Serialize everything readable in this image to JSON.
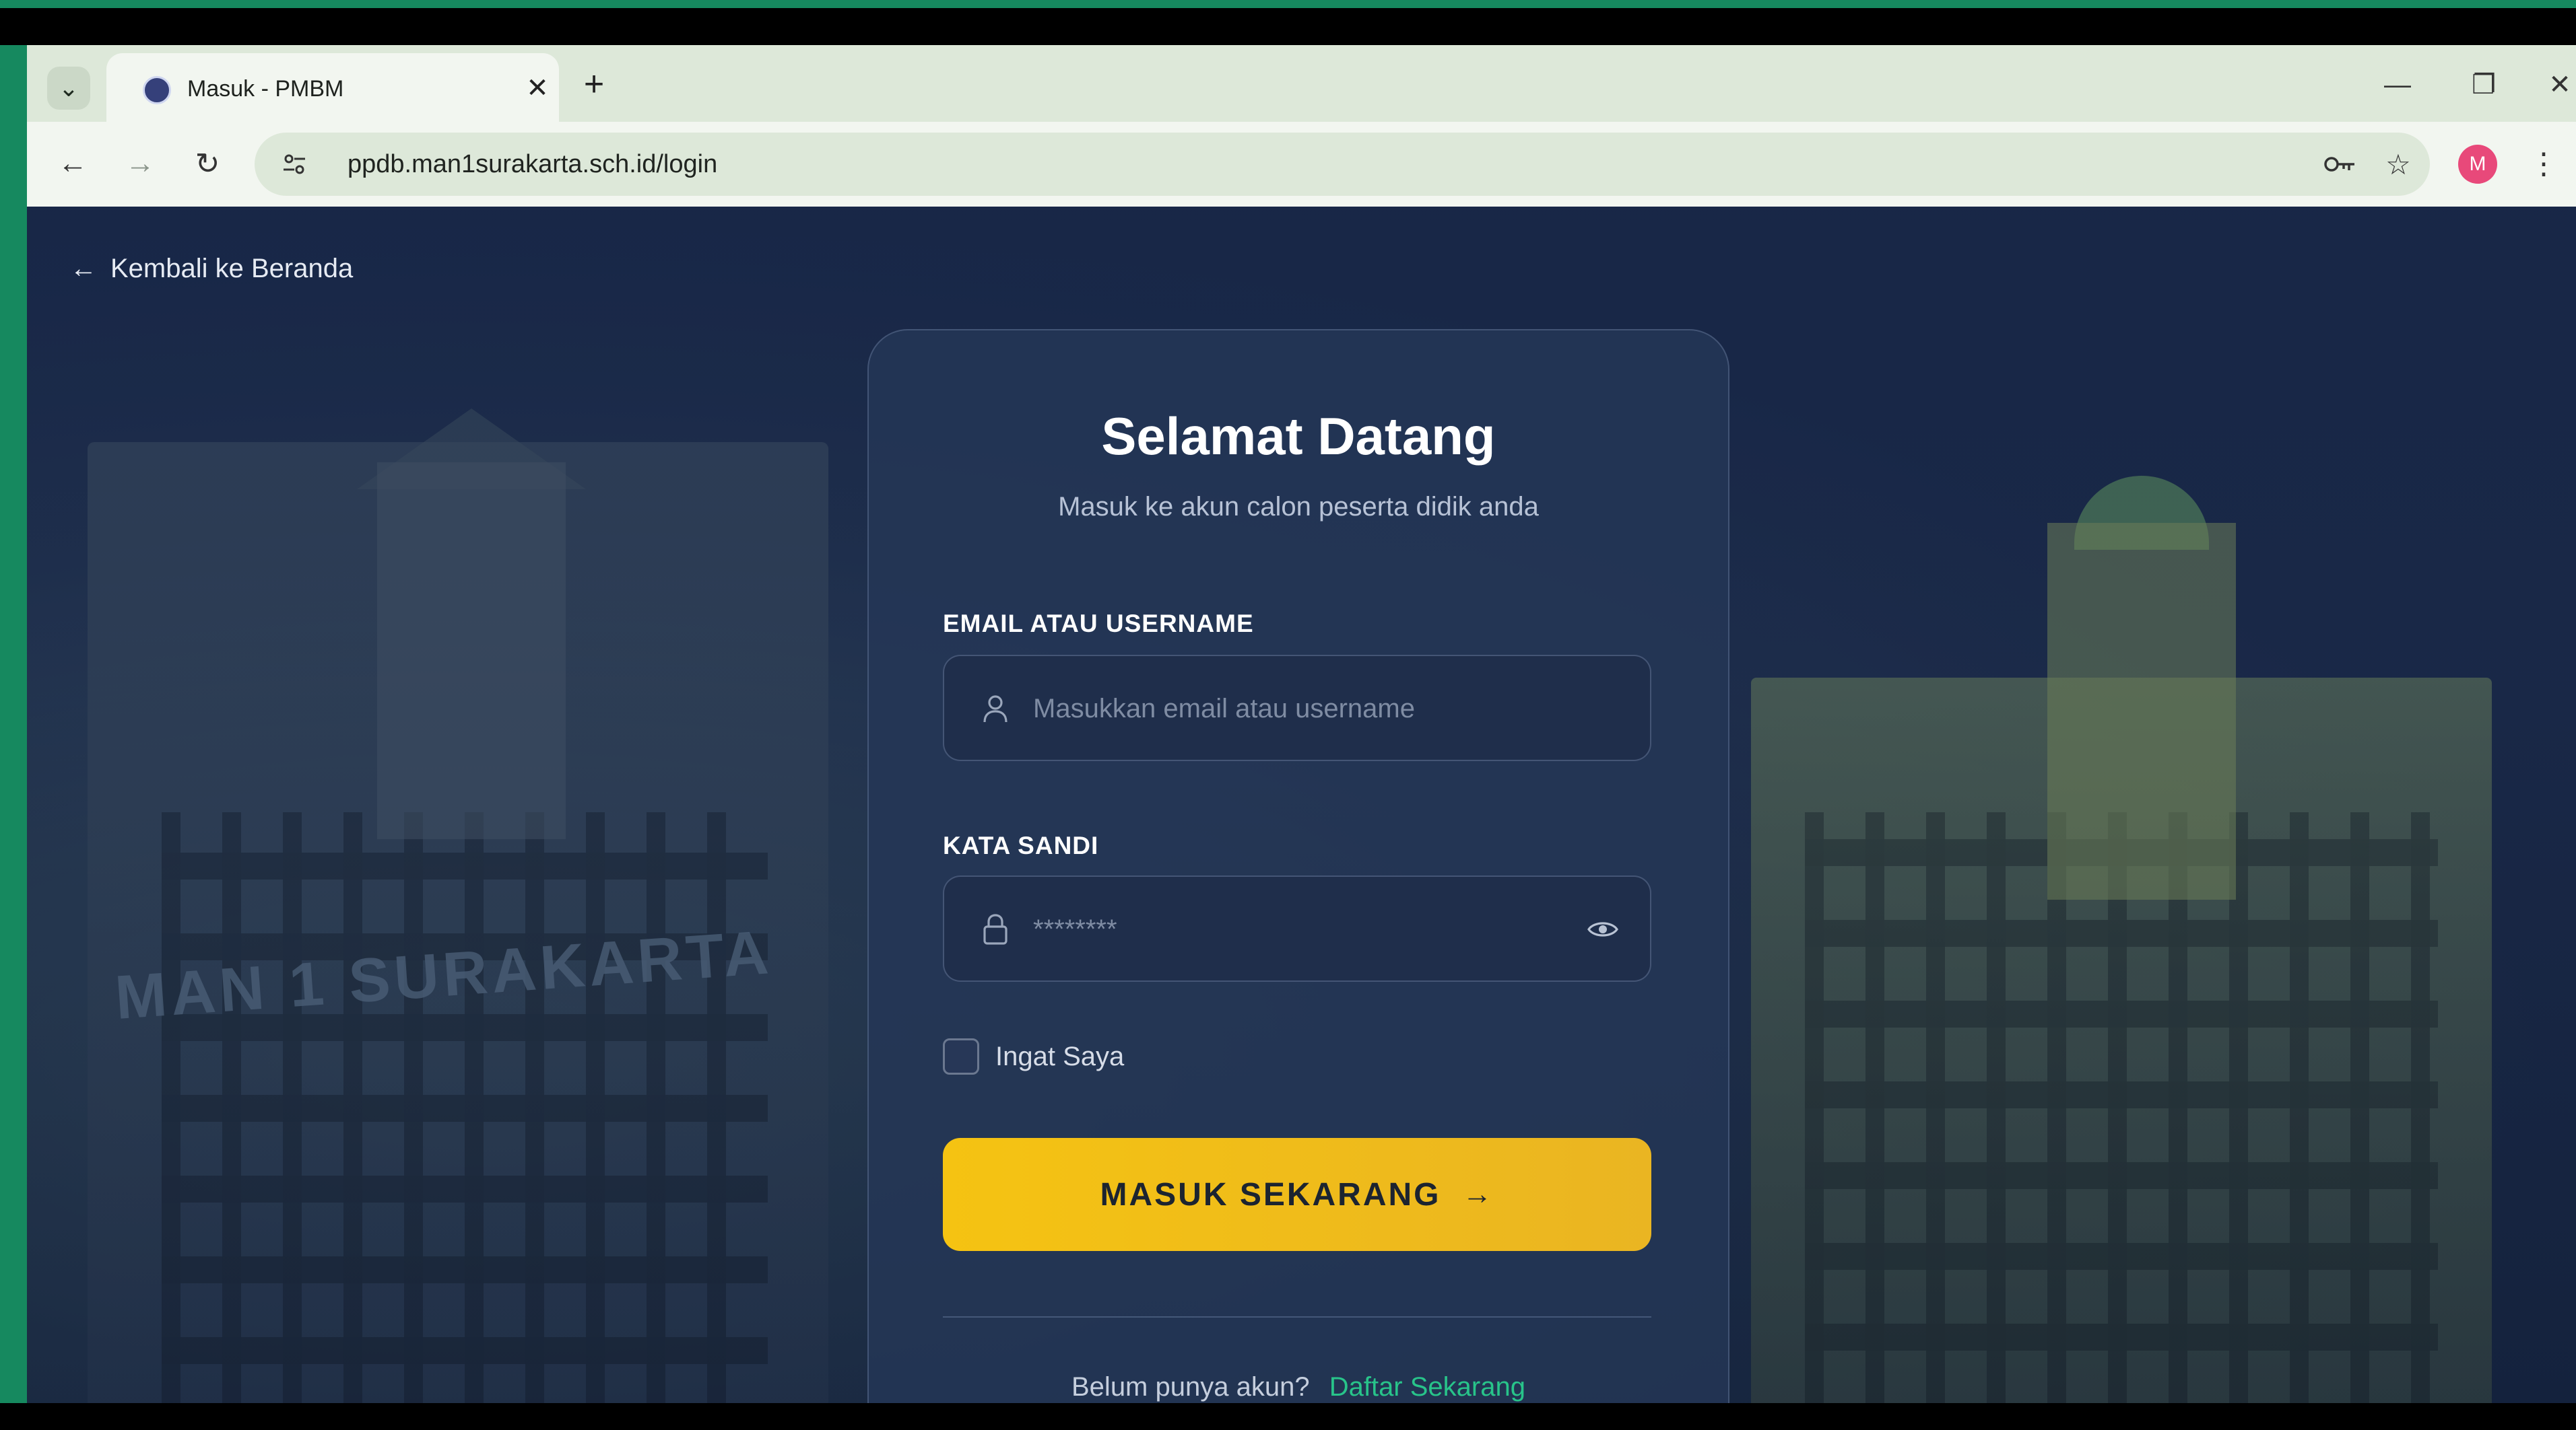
{
  "browser": {
    "tab": {
      "title": "Masuk - PMBM",
      "close_glyph": "✕"
    },
    "new_tab_glyph": "+",
    "url": "ppdb.man1surakarta.sch.id/login",
    "profile_initial": "M",
    "window_controls": {
      "minimize": "—",
      "restore": "❐",
      "close": "✕"
    }
  },
  "page": {
    "back_link": "Kembali ke Beranda",
    "background_sign": "MAN 1 SURAKARTA",
    "card": {
      "title": "Selamat Datang",
      "subtitle": "Masuk ke akun calon peserta didik anda",
      "email_label": "EMAIL ATAU USERNAME",
      "email_placeholder": "Masukkan email atau username",
      "password_label": "KATA SANDI",
      "password_placeholder": "********",
      "remember_label": "Ingat Saya",
      "submit_label": "MASUK SEKARANG",
      "signup_prompt": "Belum punya akun?",
      "signup_link": "Daftar Sekarang"
    }
  },
  "icons": {
    "tab_search": "chevron-down-icon",
    "favicon": "school-logo-icon",
    "back": "arrow-left-icon",
    "forward": "arrow-right-icon",
    "reload": "reload-icon",
    "site_info": "tune-icon",
    "password_key": "key-icon",
    "bookmark": "star-icon",
    "menu": "kebab-menu-icon",
    "user": "user-icon",
    "lock": "lock-icon",
    "eye": "eye-icon"
  },
  "colors": {
    "accent_yellow": "#f5c312",
    "link_green": "#28c48a",
    "card_bg": "#253757",
    "frame_green": "#16895f"
  }
}
